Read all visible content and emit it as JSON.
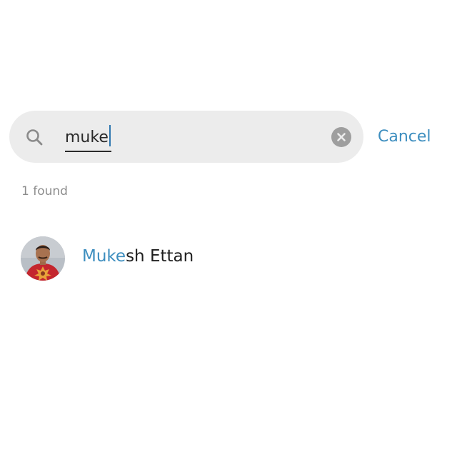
{
  "search": {
    "query": "muke",
    "cancel_label": "Cancel"
  },
  "results": {
    "count_label": "1 found",
    "items": [
      {
        "name_match": "Muke",
        "name_rest": "sh Ettan"
      }
    ]
  },
  "colors": {
    "accent": "#3d8ebf",
    "search_background": "#ececec",
    "muted_text": "#8c8c8c",
    "clear_icon": "#9e9e9e"
  },
  "icons": {
    "search": "search-icon",
    "clear": "clear-icon"
  }
}
